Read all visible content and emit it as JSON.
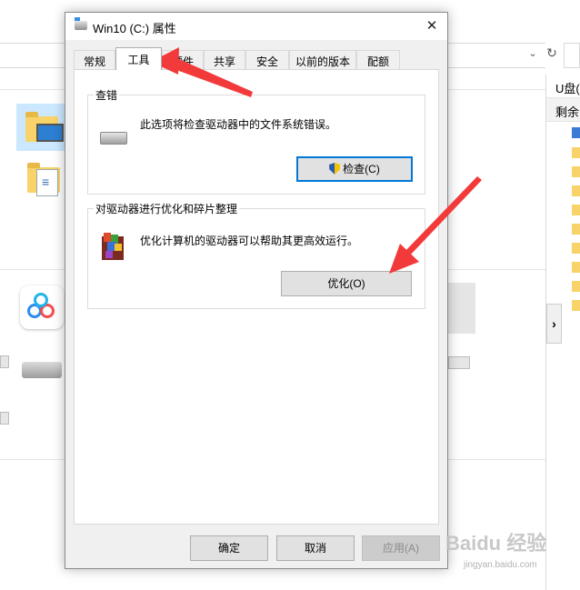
{
  "dialog": {
    "title": "Win10 (C:) 属性",
    "close_symbol": "✕",
    "tabs": [
      {
        "label": "常规",
        "active": false
      },
      {
        "label": "工具",
        "active": true
      },
      {
        "label": "硬件",
        "active": false
      },
      {
        "label": "共享",
        "active": false
      },
      {
        "label": "安全",
        "active": false
      },
      {
        "label": "以前的版本",
        "active": false
      },
      {
        "label": "配额",
        "active": false
      }
    ],
    "error_check": {
      "group_label": "查错",
      "description": "此选项将检查驱动器中的文件系统错误。",
      "button_label": "检查(C)",
      "icon": "drive-icon"
    },
    "optimize": {
      "group_label": "对驱动器进行优化和碎片整理",
      "description": "优化计算机的驱动器可以帮助其更高效运行。",
      "button_label": "优化(O)",
      "icon": "defrag-icon"
    },
    "footer": {
      "ok_label": "确定",
      "cancel_label": "取消",
      "apply_label": "应用(A)",
      "apply_enabled": false
    }
  },
  "background": {
    "right_panel": {
      "header1": "U盘(",
      "header2": "剩余"
    },
    "chevron": "›",
    "dropdown_symbol": "⌄",
    "refresh_symbol": "↻"
  },
  "watermark": {
    "text": "Baidu 经验",
    "sub": "jingyan.baidu.com"
  },
  "colors": {
    "arrow": "#f23a3a",
    "focus": "#0078d7",
    "dialog_bg": "#f0f0f0"
  }
}
